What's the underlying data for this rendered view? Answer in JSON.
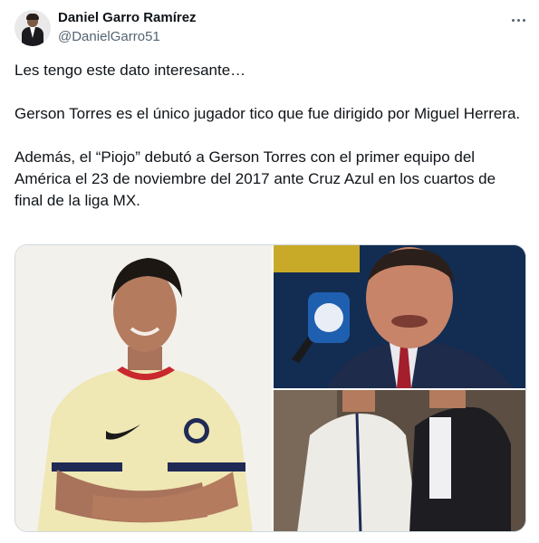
{
  "author": {
    "name": "Daniel Garro Ramírez",
    "handle": "@DanielGarro51"
  },
  "tweet": {
    "paragraphs": [
      "Les tengo este dato interesante…",
      "Gerson Torres es el único jugador tico que fue dirigido por Miguel Herrera.",
      "Además, el “Piojo” debutó a Gerson Torres con el primer equipo del América el 23 de noviembre del 2017 ante Cruz Azul en los cuartos de final de la liga MX."
    ]
  },
  "media": {
    "photo_count": 3
  },
  "colors": {
    "text": "#0f1419",
    "secondary": "#536471",
    "border": "#cfd9de"
  }
}
